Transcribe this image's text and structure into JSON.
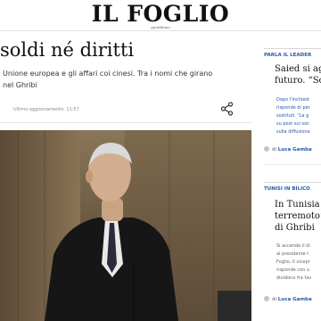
{
  "header": {
    "logo": "IL FOGLIO",
    "logo_sub": "quotidiano"
  },
  "article": {
    "title": "soldi né diritti",
    "subtitle_line1": "Unione europea e gli affari coi cinesi. Tra i nomi che girano",
    "subtitle_line2": "nel Ghribi",
    "updated": "Ultimo aggiornamento: 11:57",
    "share_icon": "share-icon"
  },
  "sidebar": {
    "items": [
      {
        "label": "PARLA IL LEADER",
        "headline_1": "Saied si ag",
        "headline_2": "futuro. “So",
        "text_lines": [
          "Dopo l'inchiest",
          "risponde di per",
          "sostituti. “La g",
          "su post sui soc",
          "sulla diffusione"
        ],
        "author_prefix": "di",
        "author": "Luca Gamba"
      },
      {
        "label": "TUNISI IN BILICO",
        "headline_1": "In Tunisia i",
        "headline_2": "terremoto”",
        "headline_3": "di Ghribi",
        "text_lines": [
          "Si accende il di",
          "al presidente t",
          "Foglio. Il vicepr",
          "risponde con u",
          "dividono fra fav"
        ],
        "author_prefix": "di",
        "author": "Luca Gamba"
      }
    ]
  },
  "colors": {
    "accent": "#2a57a6"
  }
}
